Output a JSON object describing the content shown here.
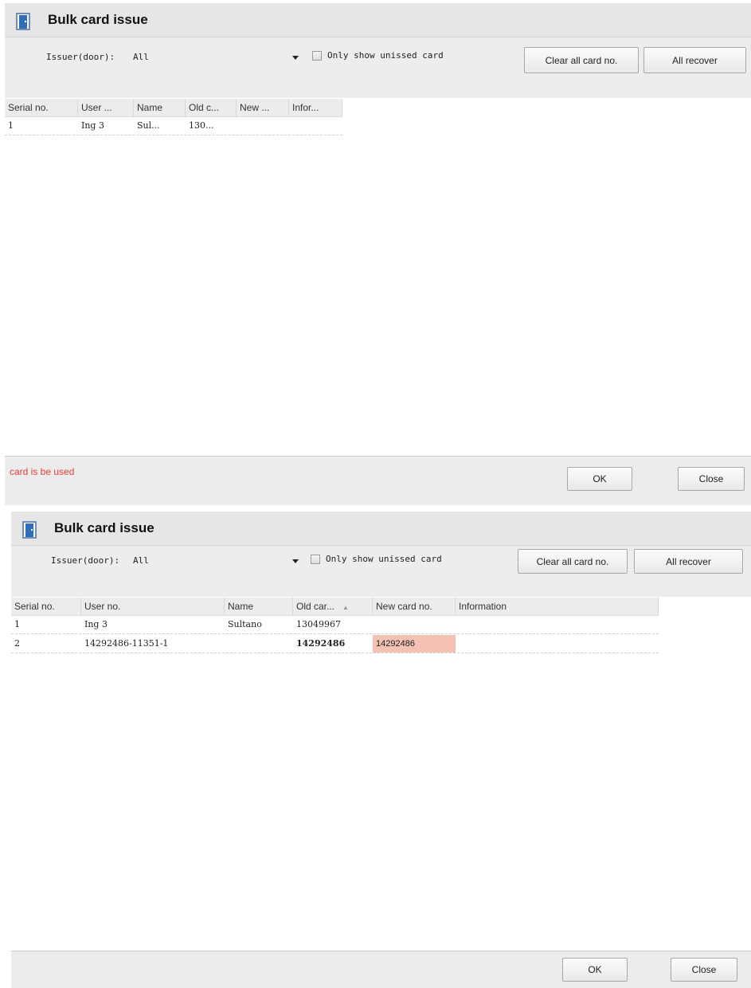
{
  "windows": [
    {
      "title": "Bulk card issue",
      "issuer_label": "Issuer(door):",
      "issuer_value": "All",
      "checkbox_label": "Only show unissed card",
      "clear_button": "Clear all card no.",
      "recover_button": "All recover",
      "columns": [
        "Serial no.",
        "User ...",
        "Name",
        "Old c...",
        "New ...",
        "Infor..."
      ],
      "rows": [
        {
          "serial": "1",
          "user": "Ing 3",
          "name": "Sul...",
          "old": "130...",
          "new": "",
          "info": ""
        }
      ],
      "status_message": "card is be used",
      "ok_button": "OK",
      "close_button": "Close"
    },
    {
      "title": "Bulk card issue",
      "issuer_label": "Issuer(door):",
      "issuer_value": "All",
      "checkbox_label": "Only show unissed card",
      "clear_button": "Clear all card no.",
      "recover_button": "All recover",
      "columns": [
        "Serial no.",
        "User no.",
        "Name",
        "Old car...",
        "New card no.",
        "Information"
      ],
      "sort_indicator": "▲",
      "rows": [
        {
          "serial": "1",
          "user": "Ing 3",
          "name": "Sultano",
          "old": "13049967",
          "new": "",
          "info": ""
        },
        {
          "serial": "2",
          "user": "14292486-11351-1",
          "name": "",
          "old": "14292486",
          "new": "14292486",
          "info": ""
        }
      ],
      "status_message": "",
      "ok_button": "OK",
      "close_button": "Close"
    }
  ],
  "colors": {
    "status_error": "#e53b3b",
    "new_card_highlight": "#f3c2b4"
  }
}
